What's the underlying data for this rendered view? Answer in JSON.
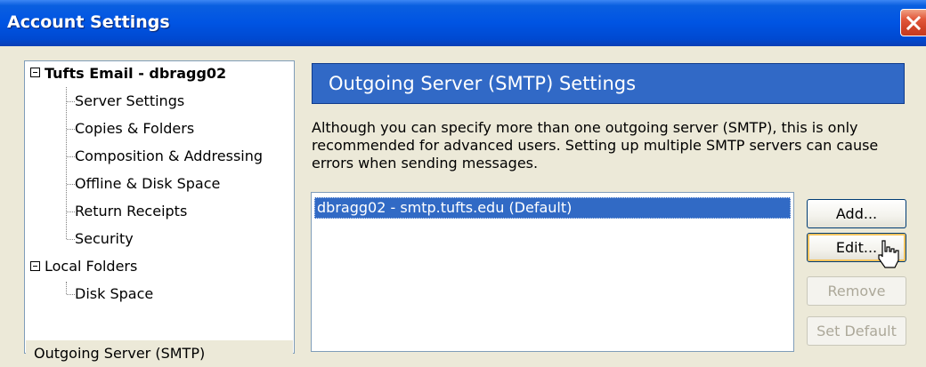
{
  "window": {
    "title": "Account Settings"
  },
  "tree": {
    "account": {
      "label": "Tufts Email - dbragg02",
      "children": [
        "Server Settings",
        "Copies & Folders",
        "Composition & Addressing",
        "Offline & Disk Space",
        "Return Receipts",
        "Security"
      ]
    },
    "local_folders": {
      "label": "Local Folders",
      "children": [
        "Disk Space"
      ]
    },
    "outgoing": {
      "label": "Outgoing Server (SMTP)",
      "selected": true
    }
  },
  "panel": {
    "header": "Outgoing Server (SMTP) Settings",
    "description_lines": [
      "Although you can specify more than one outgoing server (SMTP), this is only",
      "recommended for advanced users. Setting up multiple SMTP servers can cause",
      "errors when sending messages."
    ],
    "servers": [
      "dbragg02 - smtp.tufts.edu (Default)"
    ],
    "buttons": {
      "add": "Add...",
      "edit": "Edit...",
      "remove": "Remove",
      "set_default": "Set Default"
    }
  },
  "colors": {
    "title_bar": "#0054e3",
    "header_banner": "#3169c6",
    "selection": "#316ac5",
    "dialog_bg": "#ece9d8"
  }
}
